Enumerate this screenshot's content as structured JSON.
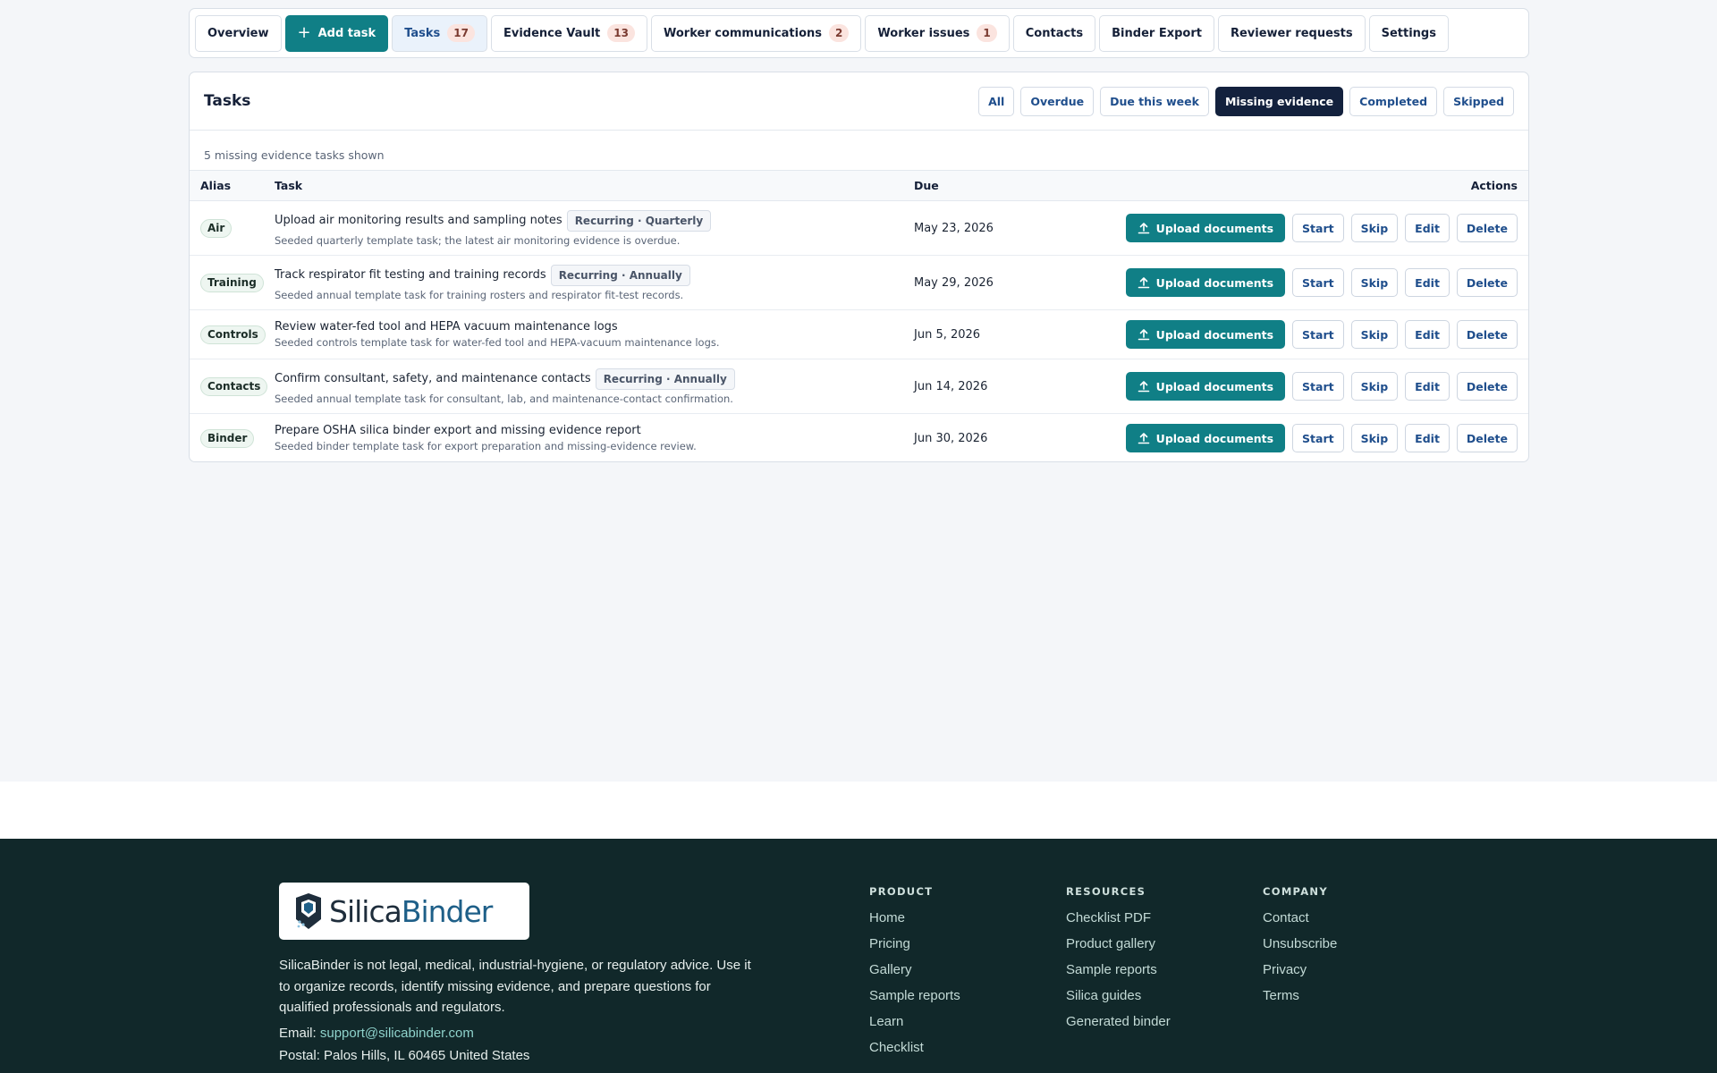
{
  "nav": {
    "overview": "Overview",
    "add_task": "Add task",
    "tasks": {
      "label": "Tasks",
      "count": "17"
    },
    "evidence_vault": {
      "label": "Evidence Vault",
      "count": "13"
    },
    "worker_communications": {
      "label": "Worker communications",
      "count": "2"
    },
    "worker_issues": {
      "label": "Worker issues",
      "count": "1"
    },
    "contacts": "Contacts",
    "binder_export": "Binder Export",
    "reviewer_requests": "Reviewer requests",
    "settings": "Settings"
  },
  "tasks_panel": {
    "title": "Tasks",
    "filters": [
      "All",
      "Overdue",
      "Due this week",
      "Missing evidence",
      "Completed",
      "Skipped"
    ],
    "active_filter": "Missing evidence",
    "shown_text": "5 missing evidence tasks shown",
    "columns": {
      "alias": "Alias",
      "task": "Task",
      "due": "Due",
      "actions": "Actions"
    },
    "action_labels": {
      "upload": "Upload documents",
      "start": "Start",
      "skip": "Skip",
      "edit": "Edit",
      "delete": "Delete"
    },
    "rows": [
      {
        "alias": "Air",
        "title": "Upload air monitoring results and sampling notes",
        "chip": "Recurring · Quarterly",
        "sub": "Seeded quarterly template task; the latest air monitoring evidence is overdue.",
        "due": "May 23, 2026"
      },
      {
        "alias": "Training",
        "title": "Track respirator fit testing and training records",
        "chip": "Recurring · Annually",
        "sub": "Seeded annual template task for training rosters and respirator fit-test records.",
        "due": "May 29, 2026"
      },
      {
        "alias": "Controls",
        "title": "Review water-fed tool and HEPA vacuum maintenance logs",
        "chip": "",
        "sub": "Seeded controls template task for water-fed tool and HEPA-vacuum maintenance logs.",
        "due": "Jun 5, 2026"
      },
      {
        "alias": "Contacts",
        "title": "Confirm consultant, safety, and maintenance contacts",
        "chip": "Recurring · Annually",
        "sub": "Seeded annual template task for consultant, lab, and maintenance-contact confirmation.",
        "due": "Jun 14, 2026"
      },
      {
        "alias": "Binder",
        "title": "Prepare OSHA silica binder export and missing evidence report",
        "chip": "",
        "sub": "Seeded binder template task for export preparation and missing-evidence review.",
        "due": "Jun 30, 2026"
      }
    ]
  },
  "footer": {
    "logo_text_a": "Silica",
    "logo_text_b": "Binder",
    "disclaimer": "SilicaBinder is not legal, medical, industrial-hygiene, or regulatory advice. Use it to organize records, identify missing evidence, and prepare questions for qualified professionals and regulators.",
    "email_label": "Email:",
    "email": "support@silicabinder.com",
    "postal": "Postal: Palos Hills, IL 60465 United States",
    "columns": [
      {
        "heading": "PRODUCT",
        "links": [
          "Home",
          "Pricing",
          "Gallery",
          "Sample reports",
          "Learn",
          "Checklist"
        ]
      },
      {
        "heading": "RESOURCES",
        "links": [
          "Checklist PDF",
          "Product gallery",
          "Sample reports",
          "Silica guides",
          "Generated binder"
        ]
      },
      {
        "heading": "COMPANY",
        "links": [
          "Contact",
          "Unsubscribe",
          "Privacy",
          "Terms"
        ]
      }
    ]
  },
  "colors": {
    "teal": "#107f86",
    "navy": "#13213d",
    "footer_bg": "#11282a",
    "link_blue": "#1f4e8c"
  },
  "icons": {
    "add": "plus-icon",
    "upload": "upload-icon",
    "logo": "shield-logo-icon"
  }
}
